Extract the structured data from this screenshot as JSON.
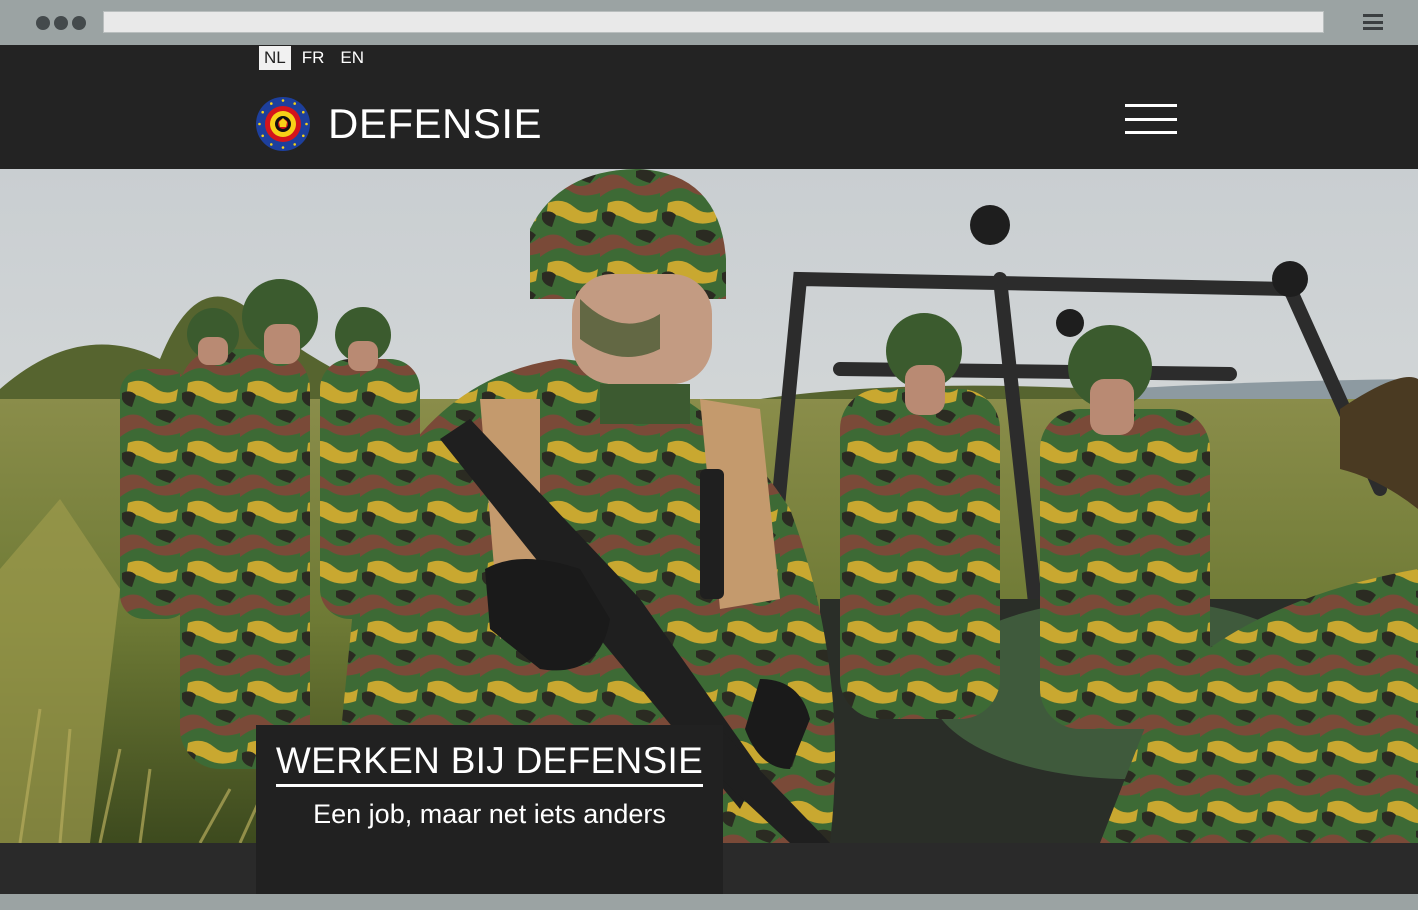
{
  "browser": {
    "window_dots": 3,
    "menu_icon": "hamburger-menu-icon"
  },
  "header": {
    "languages": [
      {
        "code": "NL",
        "active": true
      },
      {
        "code": "FR",
        "active": false
      },
      {
        "code": "EN",
        "active": false
      }
    ],
    "brand": "DEFENSIE",
    "logo_icon": "belgian-defence-roundel-icon",
    "menu_icon": "hamburger-menu-icon"
  },
  "hero": {
    "image": "soldiers-in-camouflage-photo",
    "caption_title": "WERKEN BIJ DEFENSIE",
    "caption_subtitle": "Een job, maar net iets anders"
  },
  "colors": {
    "header_bg": "#232323",
    "caption_bg": "#212121",
    "chrome_bg": "#9ba3a3",
    "text": "#ffffff"
  }
}
